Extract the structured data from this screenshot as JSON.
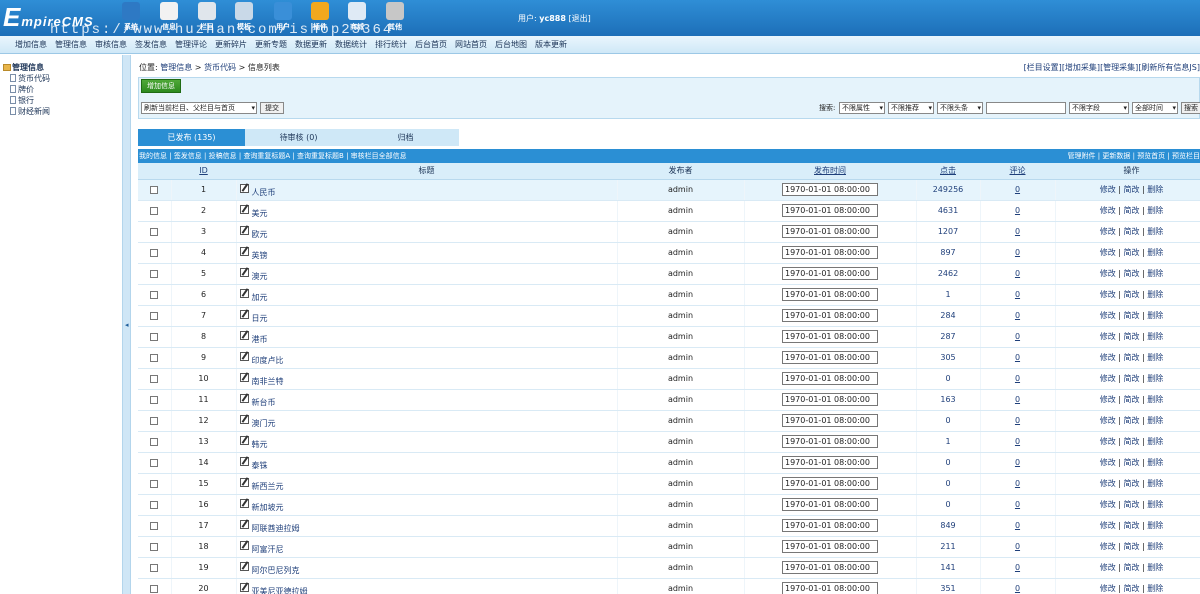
{
  "header": {
    "logo_initial": "E",
    "logo_rest": "mpireCMS",
    "watermark": "https://www.huzhan.com/ishop23364",
    "toolbar": [
      {
        "label": "系统",
        "icon": "globe-icon",
        "color": "#2e79c4"
      },
      {
        "label": "信息",
        "icon": "edit-icon",
        "color": "#f2f2f2"
      },
      {
        "label": "栏目",
        "icon": "folder-icon",
        "color": "#e0e6ec"
      },
      {
        "label": "模板",
        "icon": "window-icon",
        "color": "#c9d9e8"
      },
      {
        "label": "用户",
        "icon": "user-icon",
        "color": "#3a8fd8"
      },
      {
        "label": "插件",
        "icon": "tools-icon",
        "color": "#f2a81e"
      },
      {
        "label": "商城",
        "icon": "shop-icon",
        "color": "#dfeaf5"
      },
      {
        "label": "其他",
        "icon": "gear-icon",
        "color": "#c7c7c7"
      }
    ],
    "user_label": "用户:",
    "username": "yc888",
    "logout": "[退出]"
  },
  "menu": [
    "增加信息",
    "管理信息",
    "审核信息",
    "签发信息",
    "管理评论",
    "更新碎片",
    "更新专题",
    "数据更新",
    "数据统计",
    "排行统计",
    "后台首页",
    "网站首页",
    "后台地图",
    "版本更新"
  ],
  "sidebar": {
    "root": "管理信息",
    "items": [
      "货币代码",
      "牌价",
      "银行",
      "财经新闻"
    ]
  },
  "splitter_arrow": "◂",
  "breadcrumb": {
    "prefix": "位置:",
    "items": [
      "管理信息",
      "货币代码",
      "信息列表"
    ],
    "sep": ">"
  },
  "right_links": [
    "[栏目设置]",
    "[增加采集]",
    "[管理采集]",
    "[刷新所有信息JS]"
  ],
  "actions": {
    "add_button": "增加信息",
    "refresh_select": "刷新当前栏目、父栏目与首页",
    "submit": "提交",
    "search_label": "搜索:",
    "filters": [
      "不限属性",
      "不限推荐",
      "不限头条"
    ],
    "field_select": "不限字段",
    "time_select": "全部时间",
    "search_button": "搜索"
  },
  "tabs": [
    {
      "label": "已发布 (135)",
      "active": true
    },
    {
      "label": "待审核 (0)",
      "active": false
    },
    {
      "label": "归档",
      "active": false
    }
  ],
  "subbar": {
    "left": [
      "我的信息",
      "签发信息",
      "投稿信息",
      "查询重复标题A",
      "查询重复标题B",
      "审核栏目全部信息"
    ],
    "right": [
      "管理附件",
      "更新数据",
      "预览首页",
      "预览栏目"
    ]
  },
  "table": {
    "headers": {
      "id": "ID",
      "title": "标题",
      "publisher": "发布者",
      "time": "发布时间",
      "clicks": "点击",
      "comments": "评论",
      "ops": "操作"
    },
    "op_labels": [
      "修改",
      "简改",
      "删除"
    ],
    "rows": [
      {
        "id": "1",
        "title": "人民币",
        "publisher": "admin",
        "time": "1970-01-01 08:00:00",
        "clicks": "249256",
        "comments": "0"
      },
      {
        "id": "2",
        "title": "美元",
        "publisher": "admin",
        "time": "1970-01-01 08:00:00",
        "clicks": "4631",
        "comments": "0"
      },
      {
        "id": "3",
        "title": "欧元",
        "publisher": "admin",
        "time": "1970-01-01 08:00:00",
        "clicks": "1207",
        "comments": "0"
      },
      {
        "id": "4",
        "title": "英镑",
        "publisher": "admin",
        "time": "1970-01-01 08:00:00",
        "clicks": "897",
        "comments": "0"
      },
      {
        "id": "5",
        "title": "澳元",
        "publisher": "admin",
        "time": "1970-01-01 08:00:00",
        "clicks": "2462",
        "comments": "0"
      },
      {
        "id": "6",
        "title": "加元",
        "publisher": "admin",
        "time": "1970-01-01 08:00:00",
        "clicks": "1",
        "comments": "0"
      },
      {
        "id": "7",
        "title": "日元",
        "publisher": "admin",
        "time": "1970-01-01 08:00:00",
        "clicks": "284",
        "comments": "0"
      },
      {
        "id": "8",
        "title": "港币",
        "publisher": "admin",
        "time": "1970-01-01 08:00:00",
        "clicks": "287",
        "comments": "0"
      },
      {
        "id": "9",
        "title": "印度卢比",
        "publisher": "admin",
        "time": "1970-01-01 08:00:00",
        "clicks": "305",
        "comments": "0"
      },
      {
        "id": "10",
        "title": "南非兰特",
        "publisher": "admin",
        "time": "1970-01-01 08:00:00",
        "clicks": "0",
        "comments": "0"
      },
      {
        "id": "11",
        "title": "新台币",
        "publisher": "admin",
        "time": "1970-01-01 08:00:00",
        "clicks": "163",
        "comments": "0"
      },
      {
        "id": "12",
        "title": "澳门元",
        "publisher": "admin",
        "time": "1970-01-01 08:00:00",
        "clicks": "0",
        "comments": "0"
      },
      {
        "id": "13",
        "title": "韩元",
        "publisher": "admin",
        "time": "1970-01-01 08:00:00",
        "clicks": "1",
        "comments": "0"
      },
      {
        "id": "14",
        "title": "泰铢",
        "publisher": "admin",
        "time": "1970-01-01 08:00:00",
        "clicks": "0",
        "comments": "0"
      },
      {
        "id": "15",
        "title": "新西兰元",
        "publisher": "admin",
        "time": "1970-01-01 08:00:00",
        "clicks": "0",
        "comments": "0"
      },
      {
        "id": "16",
        "title": "新加坡元",
        "publisher": "admin",
        "time": "1970-01-01 08:00:00",
        "clicks": "0",
        "comments": "0"
      },
      {
        "id": "17",
        "title": "阿联酋迪拉姆",
        "publisher": "admin",
        "time": "1970-01-01 08:00:00",
        "clicks": "849",
        "comments": "0"
      },
      {
        "id": "18",
        "title": "阿富汗尼",
        "publisher": "admin",
        "time": "1970-01-01 08:00:00",
        "clicks": "211",
        "comments": "0"
      },
      {
        "id": "19",
        "title": "阿尔巴尼列克",
        "publisher": "admin",
        "time": "1970-01-01 08:00:00",
        "clicks": "141",
        "comments": "0"
      },
      {
        "id": "20",
        "title": "亚美尼亚德拉姆",
        "publisher": "admin",
        "time": "1970-01-01 08:00:00",
        "clicks": "351",
        "comments": "0"
      }
    ]
  }
}
